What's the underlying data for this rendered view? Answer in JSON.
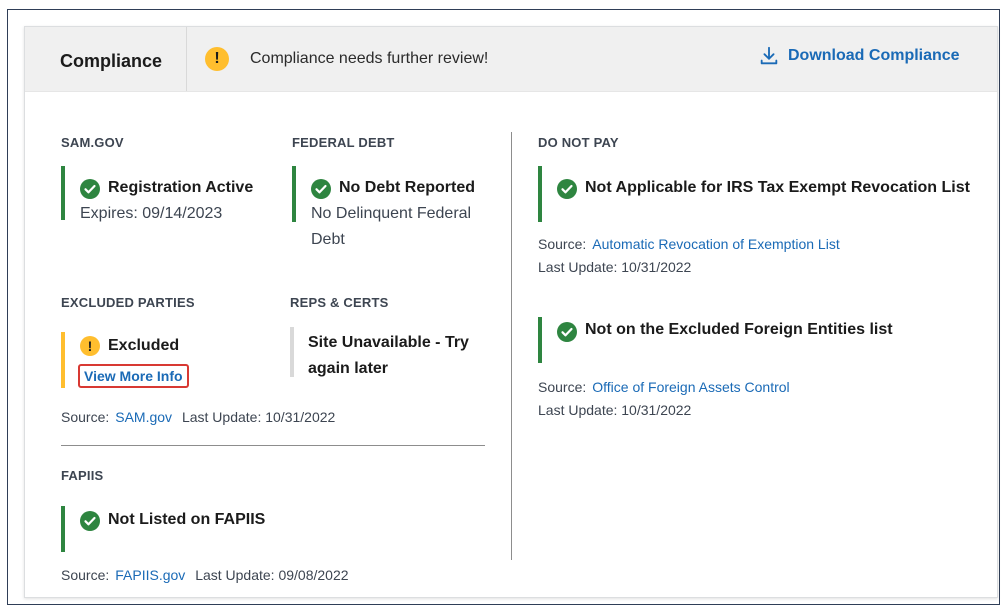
{
  "header": {
    "title": "Compliance",
    "message": "Compliance needs further review!",
    "warning_glyph": "!",
    "download_label": "Download Compliance"
  },
  "sam": {
    "label": "SAM.GOV",
    "status": "Registration Active",
    "detail": "Expires: 09/14/2023"
  },
  "federal_debt": {
    "label": "FEDERAL DEBT",
    "status": "No Debt Reported",
    "detail_line1": "No Delinquent Federal",
    "detail_line2": "Debt"
  },
  "excluded": {
    "label": "EXCLUDED PARTIES",
    "status": "Excluded",
    "warning_glyph": "!",
    "link": "View More Info"
  },
  "reps": {
    "label": "REPS & CERTS",
    "status_line1": "Site Unavailable - Try",
    "status_line2": "again later"
  },
  "sam_source": {
    "source_prefix": "Source:",
    "source_link": "SAM.gov",
    "update": "Last Update: 10/31/2022"
  },
  "fapiis": {
    "label": "FAPIIS",
    "status": "Not Listed on FAPIIS",
    "source_prefix": "Source:",
    "source_link": "FAPIIS.gov",
    "update": "Last Update: 09/08/2022"
  },
  "do_not_pay": {
    "label": "DO NOT PAY",
    "items": [
      {
        "status": "Not Applicable for IRS Tax Exempt Revocation List",
        "source_prefix": "Source:",
        "source_link": "Automatic Revocation of Exemption List",
        "update": "Last Update: 10/31/2022"
      },
      {
        "status": "Not on the Excluded Foreign Entities list",
        "source_prefix": "Source:",
        "source_link": "Office of Foreign Assets Control",
        "update": "Last Update: 10/31/2022"
      }
    ]
  },
  "colors": {
    "success": "#2e8540",
    "warning": "#ffbe2e",
    "link": "#1a6ab6",
    "alert_outline": "#d83933"
  },
  "icons": {
    "download": "download-icon",
    "check": "check-circle-icon",
    "warning": "warning-icon"
  }
}
